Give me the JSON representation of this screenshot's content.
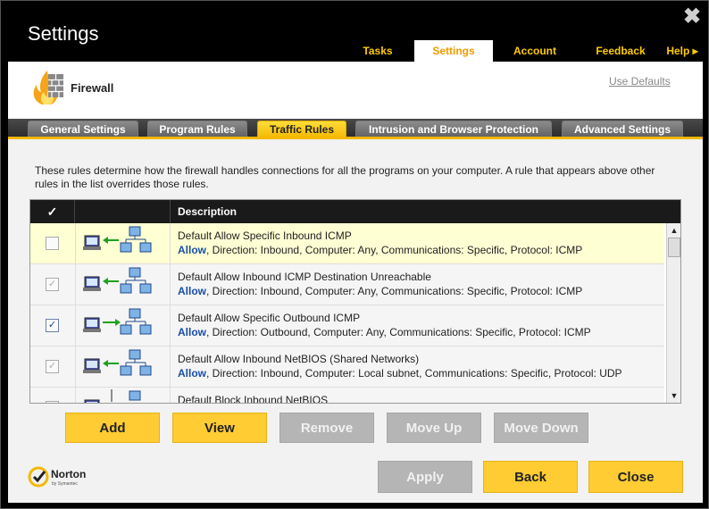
{
  "window": {
    "title": "Settings",
    "close_glyph": "✖"
  },
  "top_tabs": [
    {
      "label": "Tasks",
      "active": false
    },
    {
      "label": "Settings",
      "active": true
    },
    {
      "label": "Account",
      "active": false
    },
    {
      "label": "Feedback",
      "active": false
    },
    {
      "label": "Help ▸",
      "active": false
    }
  ],
  "header": {
    "section": "Firewall",
    "use_defaults": "Use Defaults"
  },
  "sub_tabs": [
    {
      "label": "General Settings",
      "active": false
    },
    {
      "label": "Program Rules",
      "active": false
    },
    {
      "label": "Traffic Rules",
      "active": true
    },
    {
      "label": "Intrusion and Browser Protection",
      "active": false
    },
    {
      "label": "Advanced Settings",
      "active": false
    }
  ],
  "description": "These rules determine how the firewall handles connections for all the programs on your computer. A rule that appears above other rules in the list overrides those rules.",
  "table": {
    "headers": {
      "check": "✓",
      "description": "Description"
    },
    "rows": [
      {
        "name": "Default Allow Specific Inbound ICMP",
        "action": "Allow",
        "details": ", Direction: Inbound, Computer: Any, Communications: Specific, Protocol: ICMP",
        "checked": false,
        "enabled": true,
        "selected": true,
        "direction": "inbound"
      },
      {
        "name": "Default Allow Inbound ICMP Destination Unreachable",
        "action": "Allow",
        "details": ", Direction: Inbound, Computer: Any, Communications: Specific, Protocol: ICMP",
        "checked": true,
        "enabled": false,
        "selected": false,
        "direction": "inbound"
      },
      {
        "name": "Default Allow Specific Outbound ICMP",
        "action": "Allow",
        "details": ", Direction: Outbound, Computer: Any, Communications: Specific, Protocol: ICMP",
        "checked": true,
        "enabled": true,
        "selected": false,
        "direction": "outbound"
      },
      {
        "name": "Default Allow Inbound NetBIOS (Shared Networks)",
        "action": "Allow",
        "details": ", Direction: Inbound, Computer: Local subnet, Communications: Specific, Protocol: UDP",
        "checked": true,
        "enabled": false,
        "selected": false,
        "direction": "inbound"
      },
      {
        "name": "Default Block Inbound NetBIOS",
        "action": "",
        "details": "",
        "checked": false,
        "enabled": true,
        "selected": false,
        "direction": "inbound"
      }
    ]
  },
  "list_buttons": {
    "add": "Add",
    "view": "View",
    "remove": "Remove",
    "move_up": "Move Up",
    "move_down": "Move Down"
  },
  "footer_buttons": {
    "apply": "Apply",
    "back": "Back",
    "close": "Close"
  },
  "brand": {
    "logo_text": "Norton",
    "logo_sub": "by Symantec"
  },
  "colors": {
    "accent": "#ffcc33",
    "tab_text": "#ffcc00",
    "allow": "#1a4fa8",
    "selected_row": "#ffffd4"
  }
}
